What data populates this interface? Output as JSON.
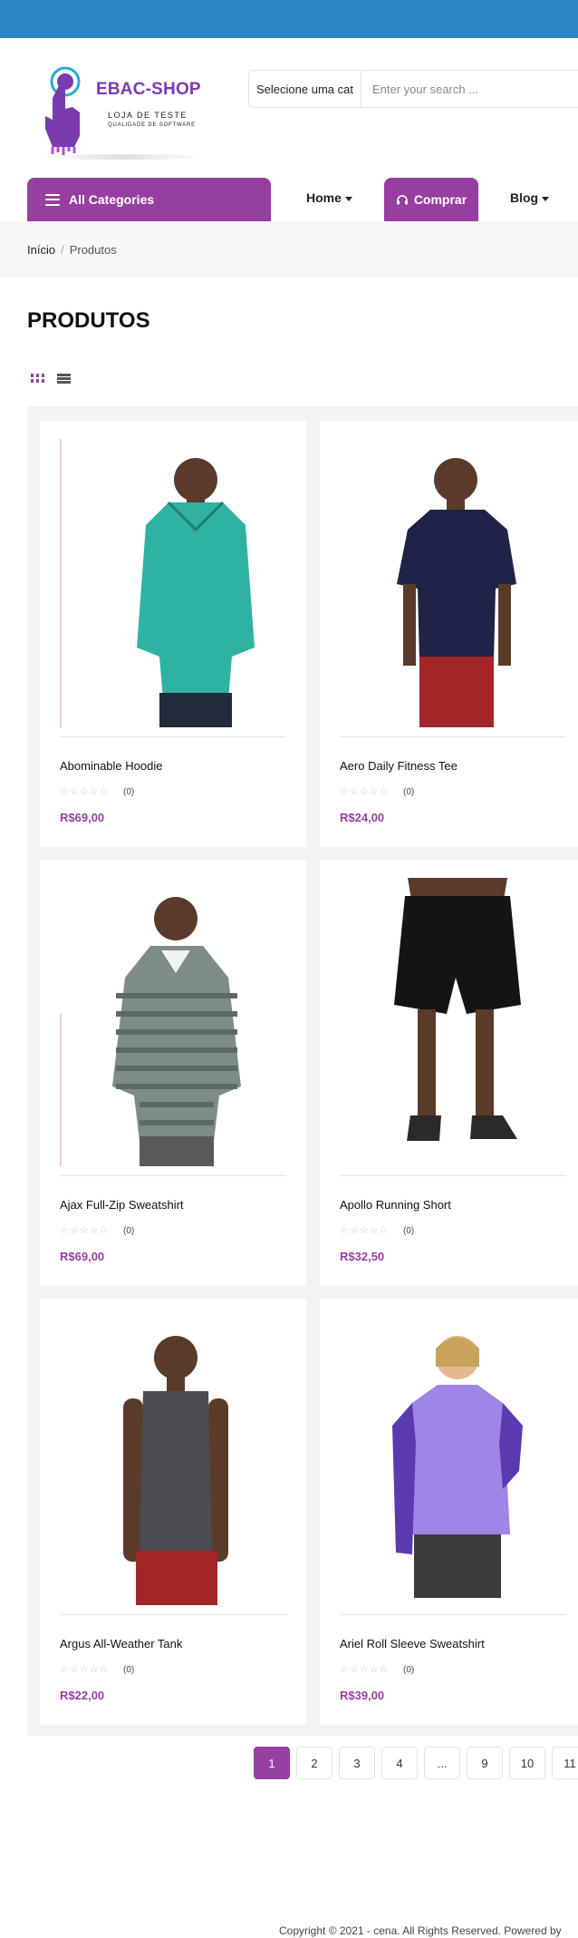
{
  "brand": {
    "name": "EBAC-SHOP",
    "tagline": "LOJA DE TESTE",
    "subtagline": "QUALIDADE DE SOFTWARE"
  },
  "search": {
    "category_label": "Selecione uma cat",
    "placeholder": "Enter your search ..."
  },
  "nav": {
    "all_categories": "All Categories",
    "home": "Home",
    "comprar": "Comprar",
    "blog": "Blog"
  },
  "breadcrumb": {
    "home": "Início",
    "current": "Produtos"
  },
  "page": {
    "title": "PRODUTOS"
  },
  "products": [
    {
      "name": "Abominable Hoodie",
      "reviews": "(0)",
      "price": "R$69,00",
      "rating": 0
    },
    {
      "name": "Aero Daily Fitness Tee",
      "reviews": "(0)",
      "price": "R$24,00",
      "rating": 0
    },
    {
      "name": "Ajax Full-Zip Sweatshirt",
      "reviews": "(0)",
      "price": "R$69,00",
      "rating": 0
    },
    {
      "name": "Apollo Running Short",
      "reviews": "(0)",
      "price": "R$32,50",
      "rating": 0
    },
    {
      "name": "Argus All-Weather Tank",
      "reviews": "(0)",
      "price": "R$22,00",
      "rating": 0
    },
    {
      "name": "Ariel Roll Sleeve Sweatshirt",
      "reviews": "(0)",
      "price": "R$39,00",
      "rating": 0
    }
  ],
  "pagination": {
    "pages": [
      "1",
      "2",
      "3",
      "4",
      "...",
      "9",
      "10",
      "11"
    ],
    "current": "1"
  },
  "footer": {
    "copyright": "Copyright © 2021 - cena. All Rights Reserved. Powered by"
  },
  "colors": {
    "topbar": "#2b86c8",
    "accent": "#963fa0",
    "price": "#963fa0"
  },
  "icons": {
    "menu": "hamburger-icon",
    "comprar": "headset-icon",
    "grid_view": "grid-view-icon",
    "list_view": "list-view-icon"
  }
}
